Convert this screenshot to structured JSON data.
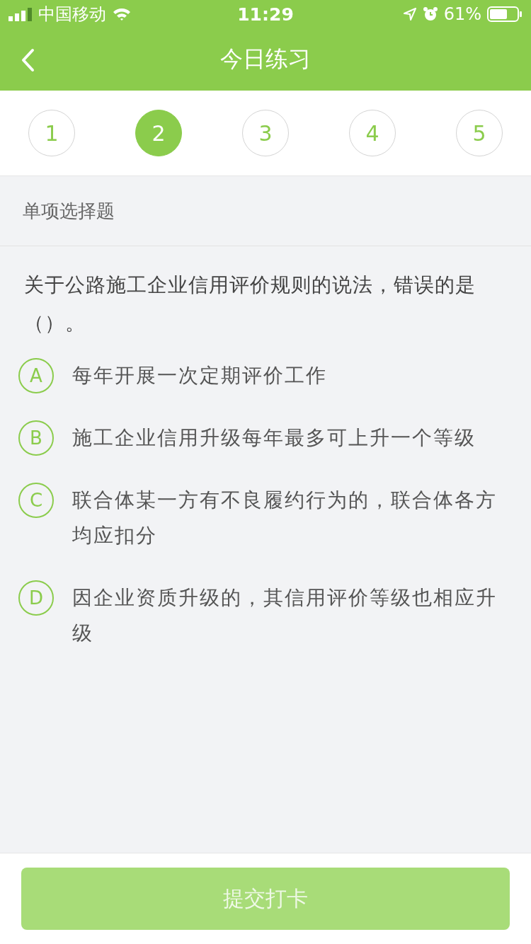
{
  "status_bar": {
    "carrier": "中国移动",
    "time": "11:29",
    "battery": "61%"
  },
  "nav": {
    "title": "今日练习"
  },
  "steps": [
    {
      "label": "1",
      "selected": false
    },
    {
      "label": "2",
      "selected": true
    },
    {
      "label": "3",
      "selected": false
    },
    {
      "label": "4",
      "selected": false
    },
    {
      "label": "5",
      "selected": false
    }
  ],
  "section_label": "单项选择题",
  "question": "关于公路施工企业信用评价规则的说法，错误的是（）。",
  "options": [
    {
      "letter": "A",
      "text": "每年开展一次定期评价工作"
    },
    {
      "letter": "B",
      "text": "施工企业信用升级每年最多可上升一个等级"
    },
    {
      "letter": "C",
      "text": "联合体某一方有不良履约行为的，联合体各方均应扣分"
    },
    {
      "letter": "D",
      "text": "因企业资质升级的，其信用评价等级也相应升级"
    }
  ],
  "submit": {
    "label": "提交打卡",
    "disabled": true
  }
}
